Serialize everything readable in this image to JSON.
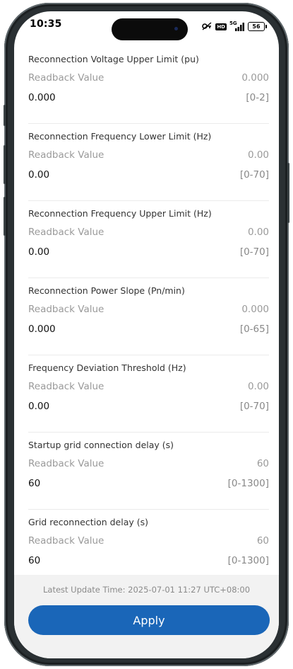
{
  "status_bar": {
    "time": "10:35",
    "network": "5G",
    "battery": "56",
    "hd_badge": "HD"
  },
  "sections": [
    {
      "title": "Reconnection Voltage Upper Limit (pu)",
      "readback_label": "Readback Value",
      "readback_value": "0.000",
      "input_value": "0.000",
      "range": "[0-2]"
    },
    {
      "title": "Reconnection Frequency Lower Limit (Hz)",
      "readback_label": "Readback Value",
      "readback_value": "0.00",
      "input_value": "0.00",
      "range": "[0-70]"
    },
    {
      "title": "Reconnection Frequency Upper Limit (Hz)",
      "readback_label": "Readback Value",
      "readback_value": "0.00",
      "input_value": "0.00",
      "range": "[0-70]"
    },
    {
      "title": "Reconnection Power Slope (Pn/min)",
      "readback_label": "Readback Value",
      "readback_value": "0.000",
      "input_value": "0.000",
      "range": "[0-65]"
    },
    {
      "title": "Frequency Deviation Threshold (Hz)",
      "readback_label": "Readback Value",
      "readback_value": "0.00",
      "input_value": "0.00",
      "range": "[0-70]"
    },
    {
      "title": "Startup grid connection delay (s)",
      "readback_label": "Readback Value",
      "readback_value": "60",
      "input_value": "60",
      "range": "[0-1300]"
    },
    {
      "title": "Grid reconnection delay (s)",
      "readback_label": "Readback Value",
      "readback_value": "60",
      "input_value": "60",
      "range": "[0-1300]"
    }
  ],
  "footer": {
    "update_time": "Latest Update Time: 2025-07-01 11:27 UTC+08:00",
    "apply_label": "Apply"
  },
  "colors": {
    "accent": "#1a66b8",
    "panel_bg": "#f2f2f2"
  }
}
